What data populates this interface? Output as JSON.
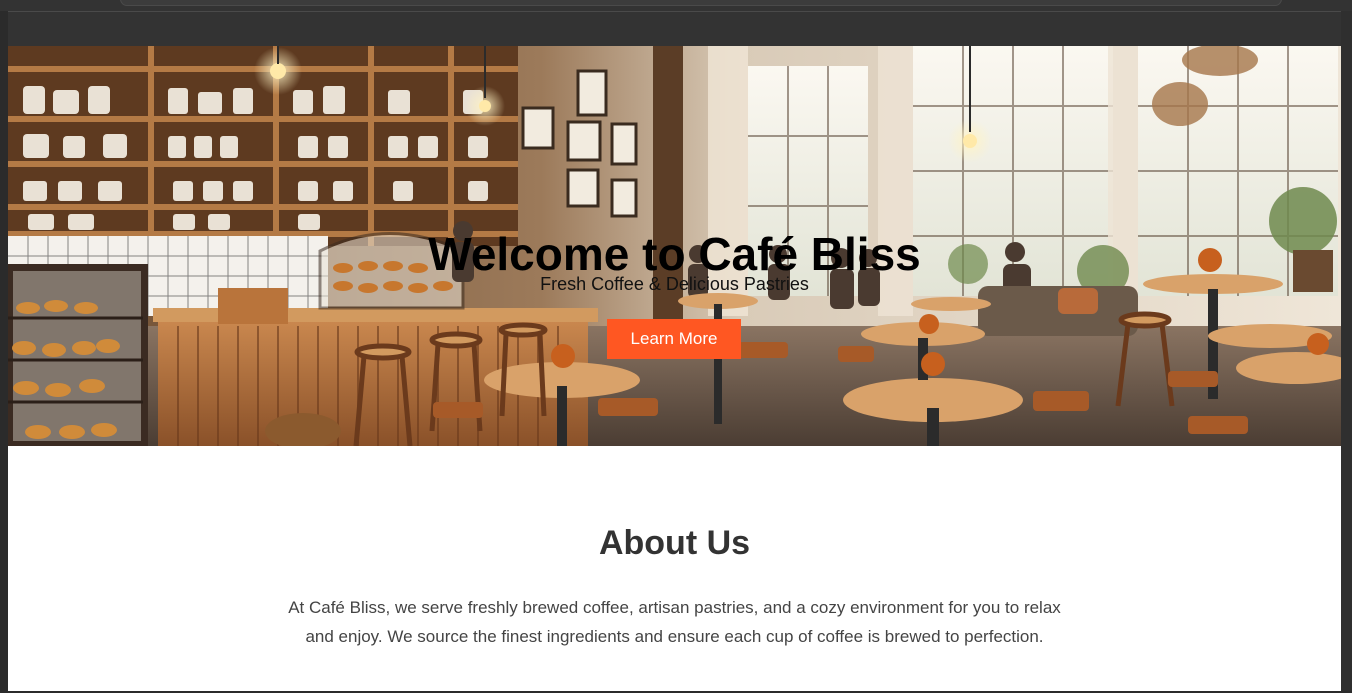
{
  "hero": {
    "title": "Welcome to Café Bliss",
    "subtitle": "Fresh Coffee & Delicious Pastries",
    "button_label": "Learn More",
    "accent_color": "#ff5722"
  },
  "about": {
    "title": "About Us",
    "text": "At Café Bliss, we serve freshly brewed coffee, artisan pastries, and a cozy environment for you to relax and enjoy. We source the finest ingredients and ensure each cup of coffee is brewed to perfection."
  },
  "icons": {
    "hero_image": "cafe-interior-image"
  }
}
